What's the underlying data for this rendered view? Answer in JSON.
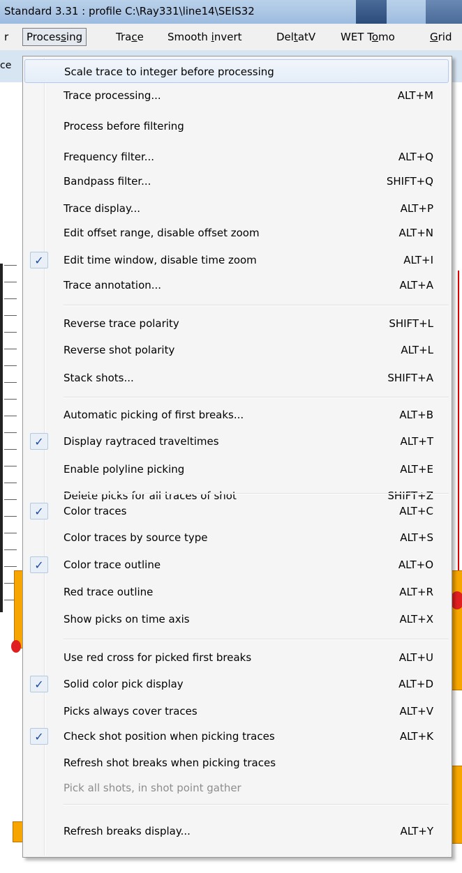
{
  "window": {
    "title": "Standard 3.31 : profile C:\\Ray331\\line14\\SEIS32"
  },
  "menubar": {
    "items": [
      {
        "label": "r"
      },
      {
        "label": "Processing",
        "active": true
      },
      {
        "label": "Trace"
      },
      {
        "label": "Smooth invert"
      },
      {
        "label": "DeltatV"
      },
      {
        "label": "WET Tomo"
      },
      {
        "label": "Grid"
      }
    ]
  },
  "toolbar_strip": {
    "label": "ce"
  },
  "menu": {
    "items": [
      {
        "label": "Scale trace to integer before processing",
        "shortcut": "",
        "checked": false,
        "highlighted": true,
        "enabled": true
      },
      {
        "label": "Trace processing...",
        "shortcut": "ALT+M",
        "checked": false,
        "enabled": true
      },
      {
        "label": "Process before filtering",
        "shortcut": "",
        "checked": false,
        "enabled": true
      },
      {
        "label": "Frequency filter...",
        "shortcut": "ALT+Q",
        "checked": false,
        "enabled": true
      },
      {
        "label": "Bandpass filter...",
        "shortcut": "SHIFT+Q",
        "checked": false,
        "enabled": true
      },
      {
        "label": "Trace display...",
        "shortcut": "ALT+P",
        "checked": false,
        "enabled": true
      },
      {
        "label": "Edit offset range, disable offset zoom",
        "shortcut": "ALT+N",
        "checked": false,
        "enabled": true
      },
      {
        "label": "Edit time window, disable time zoom",
        "shortcut": "ALT+I",
        "checked": true,
        "enabled": true
      },
      {
        "label": "Trace annotation...",
        "shortcut": "ALT+A",
        "checked": false,
        "enabled": true
      },
      {
        "label": "Reverse trace polarity",
        "shortcut": "SHIFT+L",
        "checked": false,
        "enabled": true
      },
      {
        "label": "Reverse shot polarity",
        "shortcut": "ALT+L",
        "checked": false,
        "enabled": true
      },
      {
        "label": "Stack shots...",
        "shortcut": "SHIFT+A",
        "checked": false,
        "enabled": true
      },
      {
        "label": "Automatic picking of first breaks...",
        "shortcut": "ALT+B",
        "checked": false,
        "enabled": true
      },
      {
        "label": "Display raytraced traveltimes",
        "shortcut": "ALT+T",
        "checked": true,
        "enabled": true
      },
      {
        "label": "Enable polyline picking",
        "shortcut": "ALT+E",
        "checked": false,
        "enabled": true
      },
      {
        "label": "Delete picks for all traces of shot",
        "shortcut": "SHIFT+Z",
        "checked": false,
        "enabled": true
      },
      {
        "label": "Color traces",
        "shortcut": "ALT+C",
        "checked": true,
        "enabled": true
      },
      {
        "label": "Color traces by source type",
        "shortcut": "ALT+S",
        "checked": false,
        "enabled": true
      },
      {
        "label": "Color trace outline",
        "shortcut": "ALT+O",
        "checked": true,
        "enabled": true
      },
      {
        "label": "Red trace outline",
        "shortcut": "ALT+R",
        "checked": false,
        "enabled": true
      },
      {
        "label": "Show picks on time axis",
        "shortcut": "ALT+X",
        "checked": false,
        "enabled": true
      },
      {
        "label": "Use red cross for picked first breaks",
        "shortcut": "ALT+U",
        "checked": false,
        "enabled": true
      },
      {
        "label": "Solid color pick display",
        "shortcut": "ALT+D",
        "checked": true,
        "enabled": true
      },
      {
        "label": "Picks always cover traces",
        "shortcut": "ALT+V",
        "checked": false,
        "enabled": true
      },
      {
        "label": "Check shot position when picking traces",
        "shortcut": "ALT+K",
        "checked": true,
        "enabled": true
      },
      {
        "label": "Refresh shot breaks when picking traces",
        "shortcut": "",
        "checked": false,
        "enabled": true
      },
      {
        "label": "Pick all shots, in shot point gather",
        "shortcut": "",
        "checked": false,
        "enabled": false
      },
      {
        "label": "Refresh breaks display...",
        "shortcut": "ALT+Y",
        "checked": false,
        "enabled": true
      }
    ],
    "check_glyph": "✓"
  },
  "colors": {
    "highlight_border": "#aecaf0",
    "check_color": "#1f4aa0",
    "disabled_text": "#8d8d8d"
  }
}
